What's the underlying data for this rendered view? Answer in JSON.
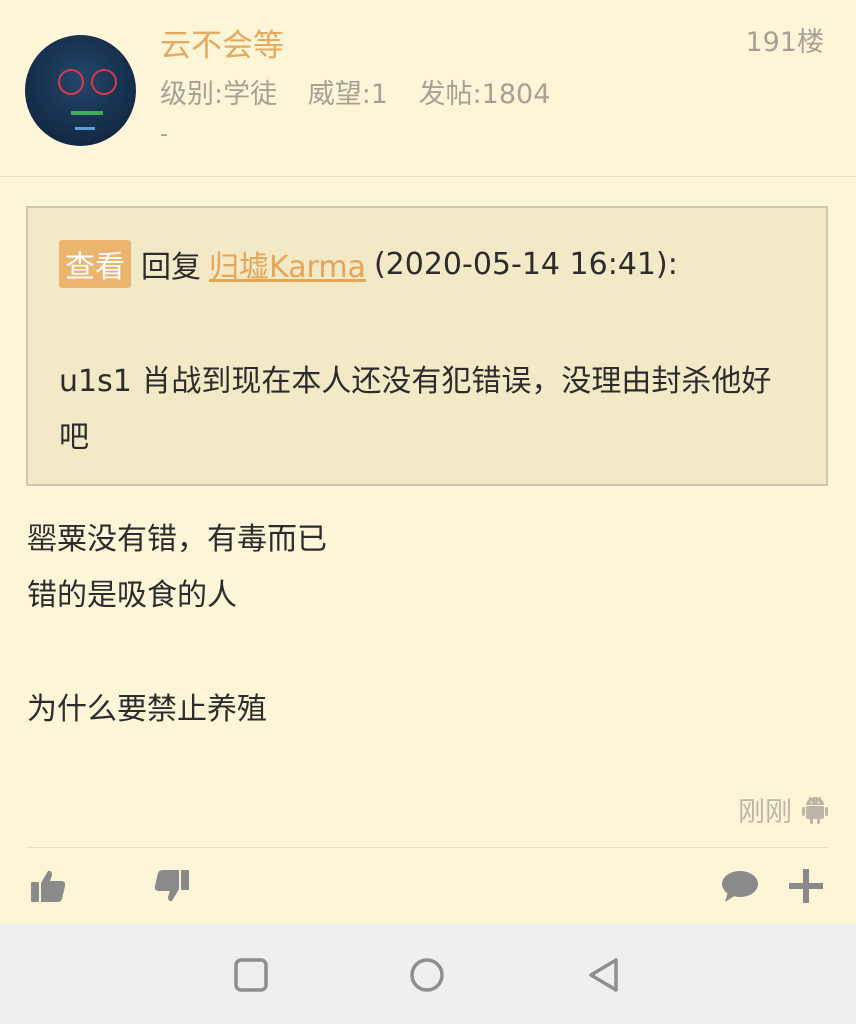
{
  "post": {
    "username": "云不会等",
    "floor": "191楼",
    "level": "级别:学徒",
    "prestige": "威望:1",
    "posts": "发帖:1804",
    "signature": "-"
  },
  "quote": {
    "view_label": "查看",
    "reply_prefix": "回复",
    "quoted_user": "归墟Karma",
    "quoted_time": "(2020-05-14 16:41):",
    "text": "u1s1 肖战到现在本人还没有犯错误，没理由封杀他好吧"
  },
  "content": {
    "line1": "罂粟没有错，有毒而已",
    "line2": "错的是吸食的人",
    "line3": "为什么要禁止养殖"
  },
  "footer": {
    "time": "刚刚",
    "device_icon": "android-icon"
  },
  "actions": {
    "like_icon": "thumbs-up-icon",
    "dislike_icon": "thumbs-down-icon",
    "comment_icon": "comment-icon",
    "more_icon": "plus-icon"
  },
  "navbar": {
    "recent_icon": "square-icon",
    "home_icon": "circle-icon",
    "back_icon": "triangle-back-icon"
  },
  "colors": {
    "background": "#fdf5d8",
    "username": "#e4aa5f",
    "meta_text": "#a8a193",
    "quote_bg": "#f2e9c6",
    "view_button": "#ebb46f"
  }
}
